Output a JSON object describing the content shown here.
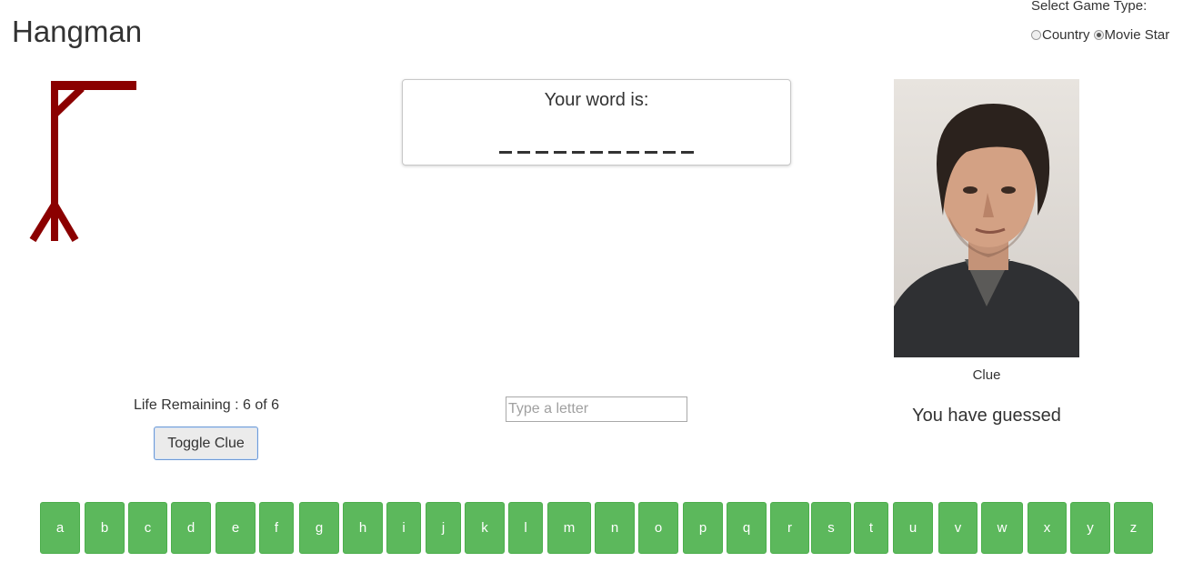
{
  "app": {
    "title": "Hangman"
  },
  "game_type": {
    "label": "Select Game Type:",
    "options": [
      {
        "label": "Country",
        "checked": false
      },
      {
        "label": "Movie Star",
        "checked": true
      }
    ]
  },
  "word_panel": {
    "label": "Your word is:",
    "blank_count": 11
  },
  "status": {
    "life_text": "Life Remaining : 6 of 6"
  },
  "toggle_clue": {
    "label": "Toggle Clue"
  },
  "letter_input": {
    "placeholder": "Type a letter",
    "value": ""
  },
  "clue": {
    "caption": "Clue"
  },
  "guessed": {
    "text": "You have guessed"
  },
  "keyboard": {
    "letters": [
      "a",
      "b",
      "c",
      "d",
      "e",
      "f",
      "g",
      "h",
      "i",
      "j",
      "k",
      "l",
      "m",
      "n",
      "o",
      "p",
      "q",
      "r",
      "s",
      "t",
      "u",
      "v",
      "w",
      "x",
      "y",
      "z"
    ]
  },
  "colors": {
    "gallows": "#8b0000",
    "key": "#5cb85c",
    "key_border": "#4cae4c",
    "key_text": "#ffffff"
  }
}
